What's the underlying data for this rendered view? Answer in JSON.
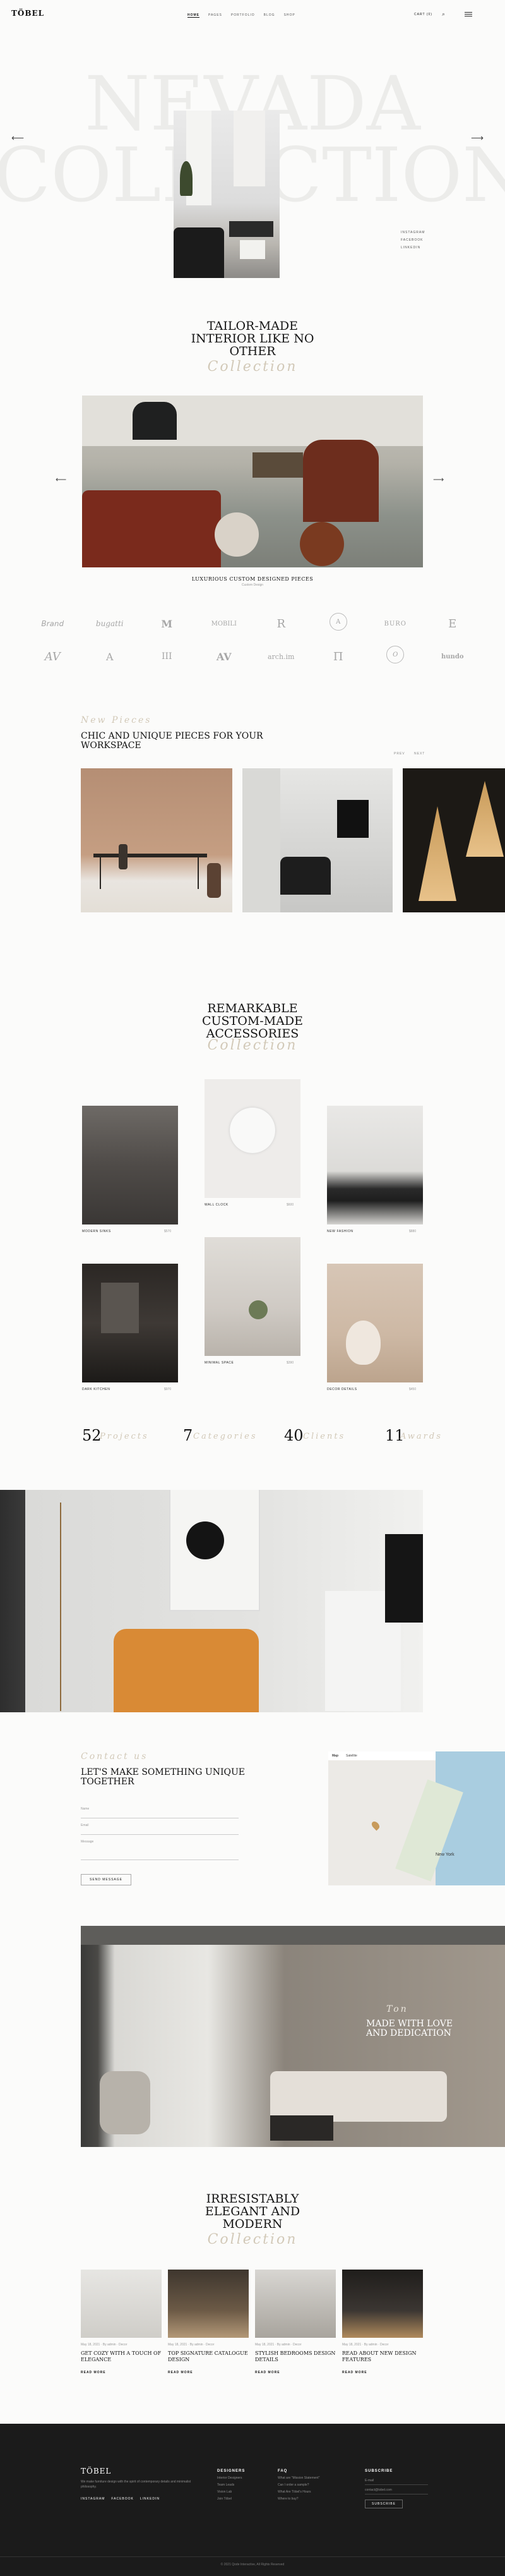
{
  "header": {
    "logo": "TÖBEL",
    "nav": [
      "HOME",
      "PAGES",
      "PORTFOLIO",
      "BLOG",
      "SHOP"
    ],
    "cart": "CART (0)"
  },
  "hero": {
    "ghost1": "NEVADA",
    "ghost2": "COLLECTION",
    "social": [
      "INSTAGRAM",
      "FACEBOOK",
      "LINKEDIN"
    ]
  },
  "tailor": {
    "title": "TAILOR-MADE INTERIOR LIKE NO OTHER",
    "script": "Collection",
    "caption": "LUXURIOUS CUSTOM DESIGNED PIECES",
    "subcaption": "Custom Design"
  },
  "brands": [
    "𝘉𝘳𝘢𝘯𝘥",
    "bugatti",
    "M",
    "MOBILI",
    "R",
    "A",
    "BURO",
    "E",
    "AV",
    "A",
    "III",
    "AV",
    "arch.im",
    "Π",
    "O",
    "hundo"
  ],
  "chic": {
    "script": "New Pieces",
    "title": "CHIC AND UNIQUE PIECES FOR YOUR WORKSPACE",
    "prev": "PREV",
    "next": "NEXT"
  },
  "remarkable": {
    "title": "REMARKABLE CUSTOM-MADE ACCESSORIES",
    "script": "Collection",
    "items": [
      {
        "name": "MODERN SINKS",
        "price": "$570"
      },
      {
        "name": "WALL CLOCK",
        "price": "$600"
      },
      {
        "name": "NEW FASHION",
        "price": "$880"
      },
      {
        "name": "DARK KITCHEN",
        "price": "$970"
      },
      {
        "name": "MINIMAL SPACE",
        "price": "$390"
      },
      {
        "name": "DECOR DETAILS",
        "price": "$450"
      }
    ]
  },
  "stats": [
    {
      "num": "52",
      "label": "Projects"
    },
    {
      "num": "7",
      "label": "Categories"
    },
    {
      "num": "40",
      "label": "Clients"
    },
    {
      "num": "11",
      "label": "Awards"
    }
  ],
  "contact": {
    "script": "Contact us",
    "title": "LET'S MAKE SOMETHING UNIQUE TOGETHER",
    "name_ph": "Name",
    "email_ph": "Email",
    "message_ph": "Message",
    "button": "SEND MESSAGE",
    "map_tab1": "Map",
    "map_tab2": "Satellite",
    "map_city": "New York"
  },
  "made": {
    "script": "Ton",
    "title": "MADE WITH LOVE AND DEDICATION"
  },
  "elegant": {
    "title": "IRRESISTABLY ELEGANT AND MODERN",
    "script": "Collection",
    "posts": [
      {
        "meta": "May 18, 2021 · By admin · Decor",
        "title": "GET COZY WITH A TOUCH OF ELEGANCE",
        "more": "READ MORE"
      },
      {
        "meta": "May 18, 2021 · By admin · Decor",
        "title": "TOP SIGNATURE CATALOGUE DESIGN",
        "more": "READ MORE"
      },
      {
        "meta": "May 18, 2021 · By admin · Decor",
        "title": "STYLISH BEDROOMS DESIGN DETAILS",
        "more": "READ MORE"
      },
      {
        "meta": "May 18, 2021 · By admin · Decor",
        "title": "READ ABOUT NEW DESIGN FEATURES",
        "more": "READ MORE"
      }
    ]
  },
  "footer": {
    "logo": "TÖBEL",
    "desc": "We make furniture design with the spirit of contemporary details and minimalist philosophy.",
    "social": [
      "INSTAGRAM",
      "FACEBOOK",
      "LINKEDIN"
    ],
    "col1": {
      "title": "DESIGNERS",
      "items": [
        "Interior Designers",
        "Team Leads",
        "Vision Lab",
        "Join Töbel"
      ]
    },
    "col2": {
      "title": "FAQ",
      "items": [
        "What are \"Mission Statement\"",
        "Can I order a sample?",
        "What Are Töbel's Hours",
        "Where to buy?"
      ]
    },
    "col3": {
      "title": "SUBSCRIBE",
      "email_ph": "E-mail",
      "email": "contact@tobel.com",
      "button": "SUBSCRIBE"
    },
    "copy": "© 2021 Qode Interactive, All Rights Reserved"
  }
}
